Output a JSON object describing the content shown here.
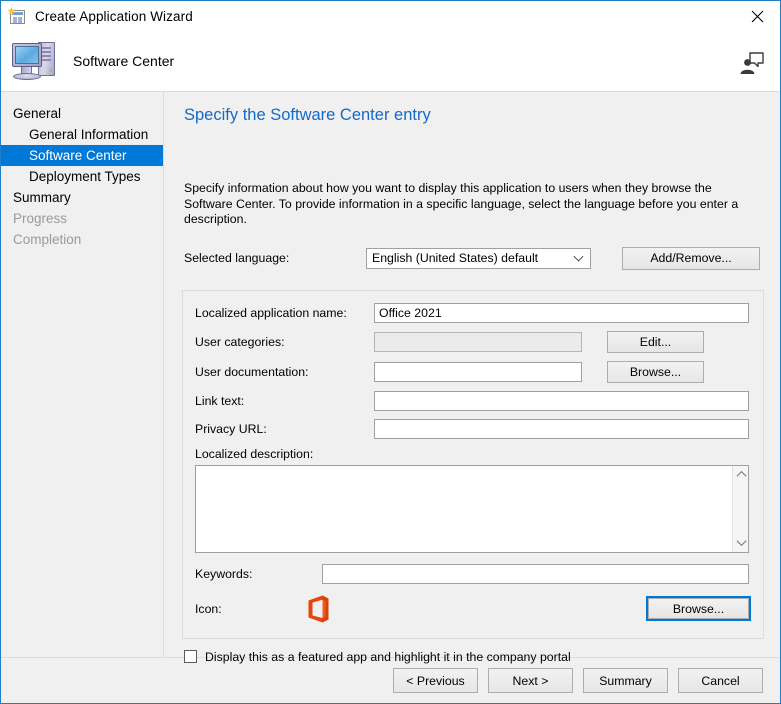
{
  "window": {
    "title": "Create Application Wizard",
    "title_icon": "wizard-page-icon",
    "close_label": "Close",
    "border_color": "#1e7ec8"
  },
  "header": {
    "title": "Software Center",
    "icon": "computer-icon",
    "assist_icon": "user-presentation-icon"
  },
  "sidebar": {
    "items": [
      {
        "label": "General",
        "level": 0,
        "state": "normal"
      },
      {
        "label": "General Information",
        "level": 1,
        "state": "normal"
      },
      {
        "label": "Software Center",
        "level": 1,
        "state": "selected"
      },
      {
        "label": "Deployment Types",
        "level": 1,
        "state": "normal"
      },
      {
        "label": "Summary",
        "level": 0,
        "state": "normal"
      },
      {
        "label": "Progress",
        "level": 0,
        "state": "disabled"
      },
      {
        "label": "Completion",
        "level": 0,
        "state": "disabled"
      }
    ],
    "selected_color": "#0078d7"
  },
  "main": {
    "page_title": "Specify the Software Center entry",
    "page_title_color": "#1569c7",
    "intro": "Specify information about how you want to display this application to users when they browse the Software Center. To provide information in a specific language, select the language before you enter a description.",
    "language": {
      "label": "Selected language:",
      "selected": "English (United States) default",
      "dropdown_icon": "chevron-down-icon",
      "add_remove_label": "Add/Remove..."
    },
    "fields": {
      "app_name": {
        "label": "Localized application name:",
        "value": "Office 2021",
        "placeholder": ""
      },
      "user_categories": {
        "label": "User categories:",
        "value": "",
        "placeholder": "",
        "button_label": "Edit...",
        "disabled": true
      },
      "user_documentation": {
        "label": "User documentation:",
        "value": "",
        "placeholder": "",
        "button_label": "Browse..."
      },
      "link_text": {
        "label": "Link text:",
        "value": "",
        "placeholder": ""
      },
      "privacy_url": {
        "label": "Privacy URL:",
        "value": "",
        "placeholder": ""
      },
      "description": {
        "label": "Localized description:",
        "value": "",
        "placeholder": "",
        "scroll_up_icon": "chevron-up-icon",
        "scroll_down_icon": "chevron-down-icon"
      },
      "keywords": {
        "label": "Keywords:",
        "value": "",
        "placeholder": ""
      },
      "icon": {
        "label": "Icon:",
        "glyph": "office-logo-icon",
        "glyph_color": "#e8450c",
        "button_label": "Browse...",
        "focus_color": "#0078d7"
      }
    },
    "featured_checkbox": {
      "label": "Display this as a featured app and highlight it in the company portal",
      "checked": false
    }
  },
  "footer": {
    "previous_label": "< Previous",
    "next_label": "Next >",
    "summary_label": "Summary",
    "cancel_label": "Cancel"
  }
}
